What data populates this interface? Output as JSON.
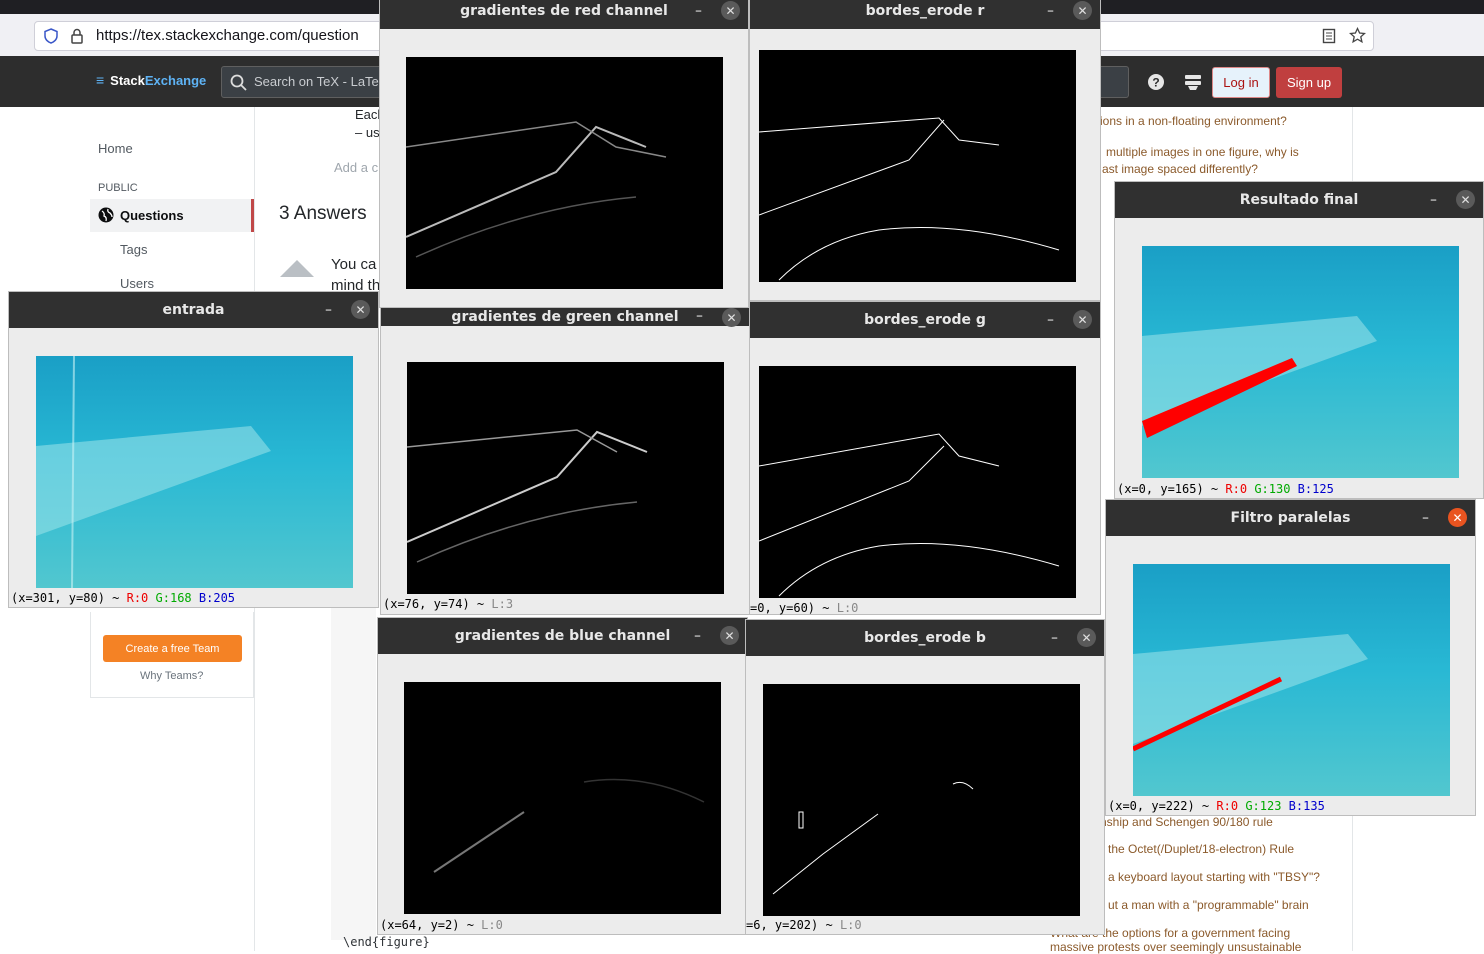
{
  "browser": {
    "url_prefix": "https://tex.",
    "url_host": "stackexchange.com",
    "url_path": "/question"
  },
  "site": {
    "logo_stack": "Stack",
    "logo_exchange": "Exchange",
    "search_placeholder": "Search on TeX - LaTe",
    "login": "Log in",
    "signup": "Sign up"
  },
  "leftnav": {
    "home": "Home",
    "public": "PUBLIC",
    "questions": "Questions",
    "tags": "Tags",
    "users": "Users",
    "create_team": "Create a free Team",
    "why_teams": "Why Teams?"
  },
  "question": {
    "each": "Each",
    "us": "– us",
    "add_comment": "Add a c",
    "answers_count": "3 Answers",
    "you_can": "You ca",
    "mind": "mind th",
    "end_figure": "\\end{figure}"
  },
  "hot": [
    "ions in a non-floating environment?",
    "multiple images in one figure, why is",
    "ast image spaced differently?",
    "nship and Schengen 90/180 rule",
    "the Octet(/Duplet/18-electron) Rule",
    "a keyboard layout starting with \"TBSY\"?",
    "ut a man with a \"programmable\" brain",
    "What are the options for a government facing",
    "massive protests over seemingly unsustainable"
  ],
  "windows": {
    "entrada": {
      "title": "entrada",
      "coords": "(x=301, y=80) ~",
      "r": "R:0",
      "g": "G:168",
      "b": "B:205"
    },
    "grad_red": {
      "title": "gradientes de red channel"
    },
    "grad_green": {
      "title": "gradientes de green channel",
      "coords": "(x=76, y=74) ~",
      "l": "L:3"
    },
    "grad_blue": {
      "title": "gradientes de blue channel",
      "coords": "(x=64, y=2) ~",
      "l": "L:0"
    },
    "erode_r": {
      "title": "bordes_erode r"
    },
    "erode_g": {
      "title": "bordes_erode g",
      "coords": "=0, y=60) ~",
      "l": "L:0"
    },
    "erode_b": {
      "title": "bordes_erode b",
      "coords": "=6, y=202) ~",
      "l": "L:0"
    },
    "final": {
      "title": "Resultado final",
      "coords": "(x=0, y=165) ~",
      "r": "R:0",
      "g": "G:130",
      "b": "B:125"
    },
    "paralelas": {
      "title": "Filtro paralelas",
      "coords": "(x=0, y=222) ~",
      "r": "R:0",
      "g": "G:123",
      "b": "B:135"
    }
  },
  "colors": {
    "accent_red": "#ff0000",
    "water": "#1fa8c8",
    "close_active": "#e95420"
  }
}
